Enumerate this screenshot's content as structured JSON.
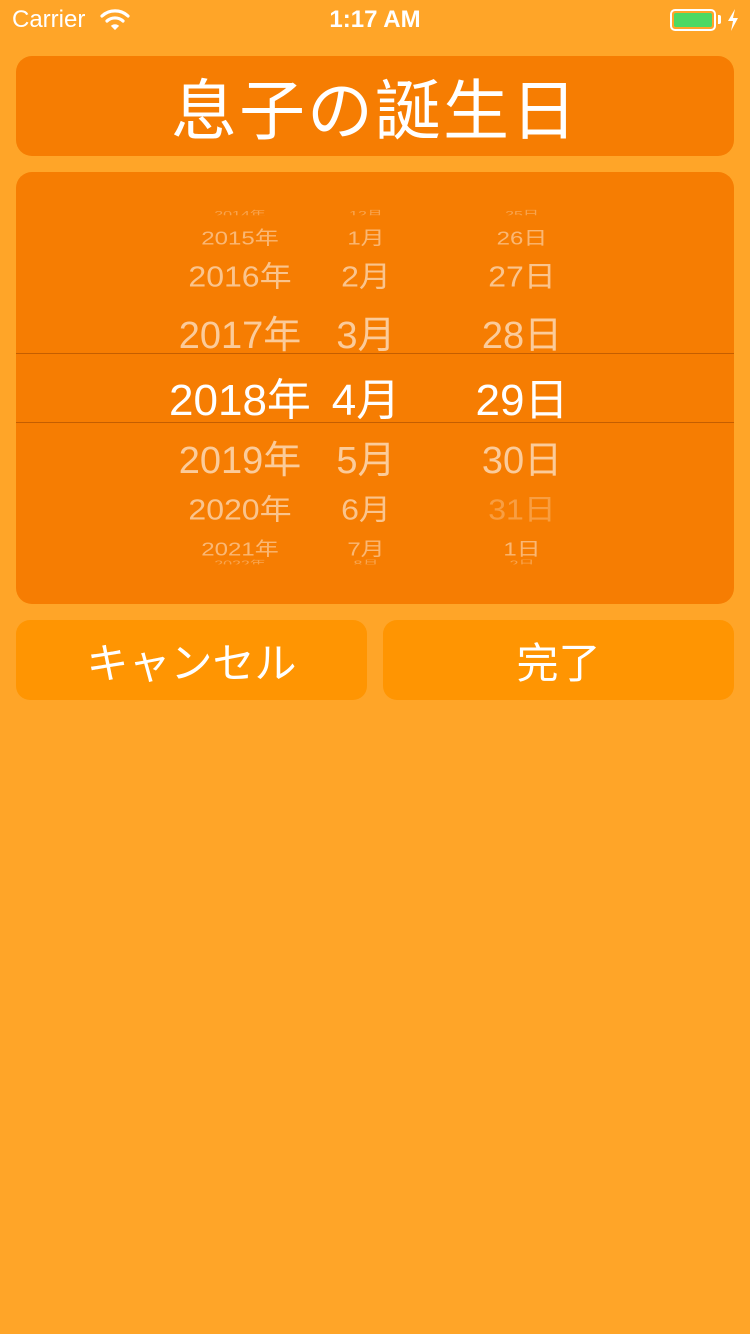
{
  "status_bar": {
    "carrier": "Carrier",
    "time": "1:17 AM"
  },
  "title": "息子の誕生日",
  "picker": {
    "years": [
      "2014年",
      "2015年",
      "2016年",
      "2017年",
      "2018年",
      "2019年",
      "2020年",
      "2021年",
      "2022年"
    ],
    "months": [
      "12月",
      "1月",
      "2月",
      "3月",
      "4月",
      "5月",
      "6月",
      "7月",
      "8月"
    ],
    "days": [
      "25日",
      "26日",
      "27日",
      "28日",
      "29日",
      "30日",
      "31日",
      "1日",
      "2日"
    ],
    "selected": {
      "year": "2018年",
      "month": "4月",
      "day": "29日"
    }
  },
  "buttons": {
    "cancel": "キャンセル",
    "done": "完了"
  },
  "colors": {
    "background": "#FFA528",
    "panel": "#F67D02",
    "button": "#FF9502",
    "battery": "#4CD964"
  }
}
